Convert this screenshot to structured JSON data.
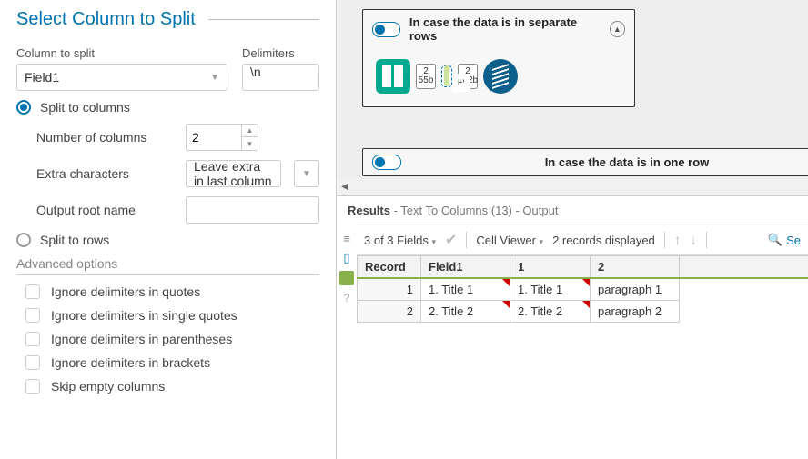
{
  "panel": {
    "title": "Select Column to Split",
    "col_label": "Column to split",
    "col_value": "Field1",
    "delim_label": "Delimiters",
    "delim_value": "\\n",
    "split_cols": "Split to columns",
    "split_rows": "Split to rows",
    "num_cols_lbl": "Number of columns",
    "num_cols_val": "2",
    "extra_lbl": "Extra characters",
    "extra_val": "Leave extra in last column",
    "rootname_lbl": "Output root name",
    "adv": "Advanced options",
    "chk": {
      "quotes": "Ignore delimiters in quotes",
      "single": "Ignore delimiters in single quotes",
      "paren": "Ignore delimiters in parentheses",
      "brack": "Ignore delimiters in brackets",
      "skip": "Skip empty columns"
    }
  },
  "canvas": {
    "grp1": "In case the data is in separate rows",
    "grp2": "In case the data is in one row",
    "conn1_top": "2",
    "conn1_bot": "55b",
    "conn2_top": "2",
    "conn2_bot": "102b"
  },
  "results": {
    "title_bold": "Results",
    "title_rest": " - Text To Columns (13) - Output",
    "fields": "3 of 3 Fields",
    "cellviewer": "Cell Viewer",
    "reccount": "2 records displayed",
    "search": "Se",
    "headers": [
      "Record",
      "Field1",
      "1",
      "2"
    ],
    "rows": [
      [
        "1",
        "1. Title 1",
        "1. Title 1",
        "paragraph 1"
      ],
      [
        "2",
        "2. Title 2",
        "2. Title 2",
        "paragraph 2"
      ]
    ]
  }
}
